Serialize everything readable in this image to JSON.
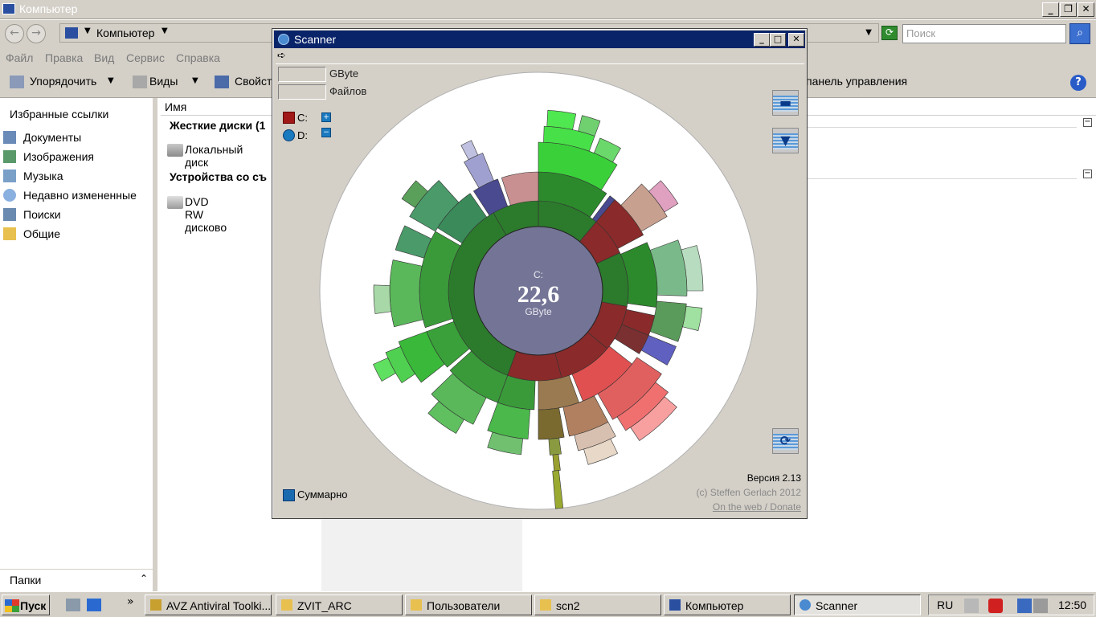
{
  "explorer": {
    "title": "Компьютер",
    "address": "Компьютер",
    "search_placeholder": "Поиск",
    "menu": [
      "Файл",
      "Правка",
      "Вид",
      "Сервис",
      "Справка"
    ],
    "toolbar": {
      "organize": "Упорядочить",
      "views": "Виды",
      "properties": "Свойст",
      "control_panel": "панель управления"
    },
    "nav": {
      "favorites_header": "Избранные ссылки",
      "items": [
        {
          "label": "Документы",
          "icon": "documents-icon"
        },
        {
          "label": "Изображения",
          "icon": "pictures-icon"
        },
        {
          "label": "Музыка",
          "icon": "music-icon"
        },
        {
          "label": "Недавно измененные",
          "icon": "recent-icon"
        },
        {
          "label": "Поиски",
          "icon": "searches-icon"
        },
        {
          "label": "Общие",
          "icon": "public-folder-icon"
        }
      ],
      "folders_label": "Папки"
    },
    "list": {
      "column_name": "Имя",
      "group_hdd": "Жесткие диски (1",
      "local_disk": "Локальный диск",
      "group_removable": "Устройства со съ",
      "dvd": "DVD RW дисково"
    }
  },
  "scanner": {
    "title": "Scanner",
    "menu_arrow": "➪",
    "size_unit": "GByte",
    "files_label": "Файлов",
    "drives": [
      {
        "label": "C:",
        "color": "#a01818"
      },
      {
        "label": "D:",
        "color": "#1a7ac0"
      }
    ],
    "center_drive": "C:",
    "center_size": "22,6",
    "center_unit": "GByte",
    "summary_label": "Суммарно",
    "version": "Версия 2.13",
    "copyright": "(c) Steffen Gerlach 2012",
    "link": "On the web / Donate"
  },
  "taskbar": {
    "start": "Пуск",
    "chevron": "»",
    "items": [
      {
        "label": "AVZ Antiviral Toolki...",
        "active": false
      },
      {
        "label": "ZVIT_ARC",
        "active": false
      },
      {
        "label": "Пользователи",
        "active": false
      },
      {
        "label": "scn2",
        "active": false
      },
      {
        "label": "Компьютер",
        "active": false
      },
      {
        "label": "Scanner",
        "active": true
      }
    ],
    "lang": "RU",
    "clock": "12:50"
  }
}
